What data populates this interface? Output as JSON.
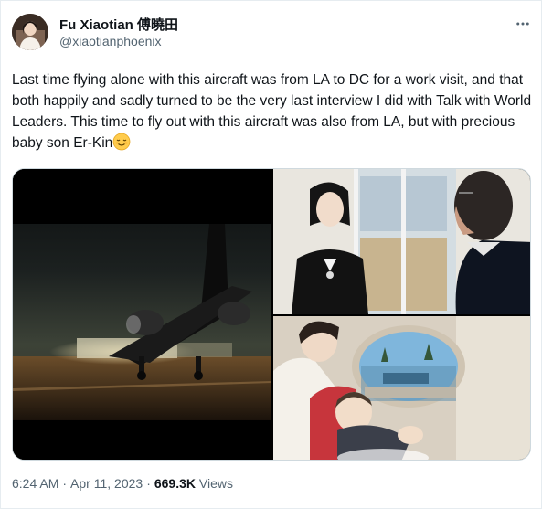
{
  "author": {
    "name": "Fu Xiaotian 傅曉田",
    "handle": "@xiaotianphoenix",
    "avatar_icon": "profile-photo"
  },
  "more_icon": "more-horizontal-icon",
  "tweet": {
    "text": "Last time flying alone with this aircraft was from LA to DC for a work visit, and that both happily and sadly turned to be the very last interview I did with Talk with World Leaders. This time to fly out with this aircraft was also from LA, but with precious baby son Er-Kin",
    "emoji": "relieved-face-emoji"
  },
  "media": {
    "count": 3,
    "images": [
      "private-jet-on-tarmac-at-night",
      "woman-in-black-jacket-and-man-by-window",
      "mother-with-baby-by-airplane-window"
    ]
  },
  "meta": {
    "time": "6:24 AM",
    "separator": "·",
    "date": "Apr 11, 2023",
    "views_count": "669.3K",
    "views_label": "Views"
  },
  "colors": {
    "text_primary": "#0f1419",
    "text_secondary": "#536471",
    "border": "#cfd9de"
  }
}
